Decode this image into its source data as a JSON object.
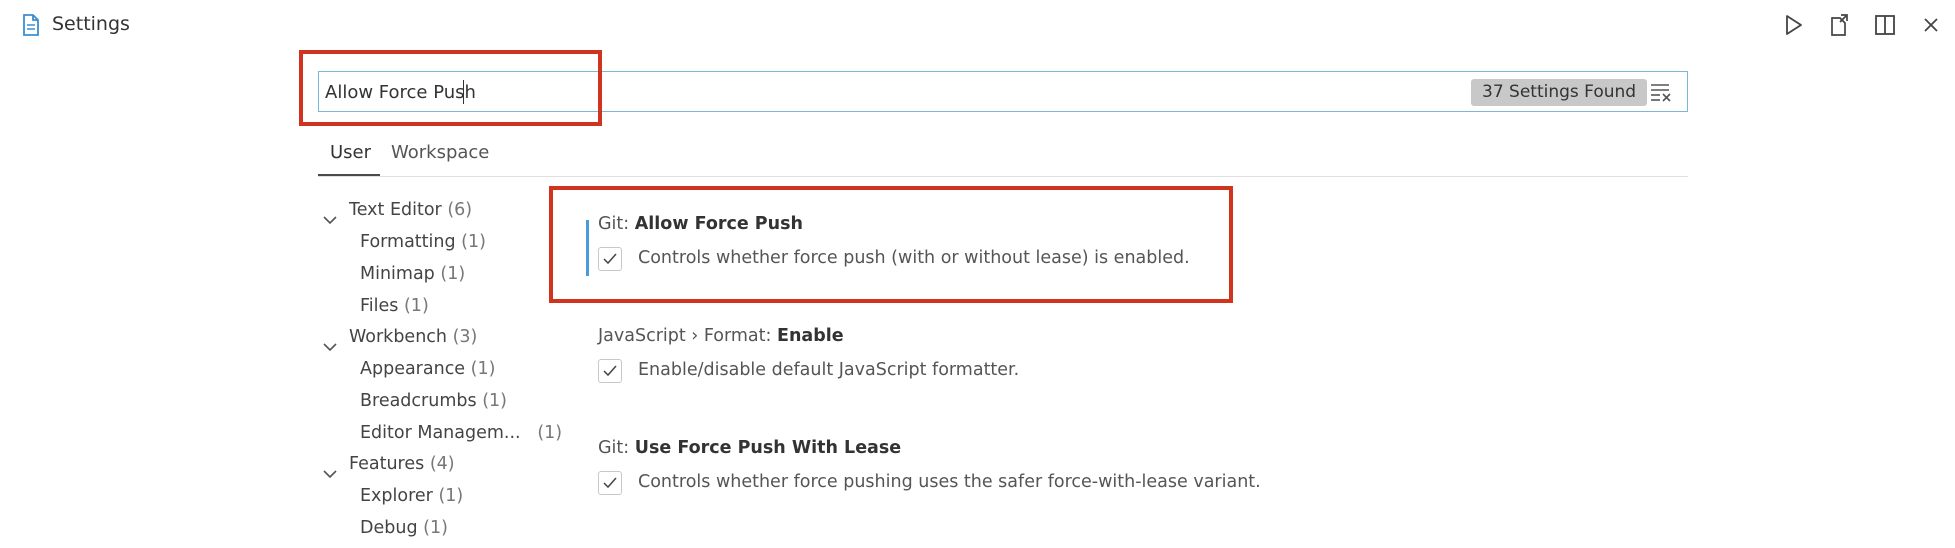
{
  "editor": {
    "tab_title": "Settings",
    "actions": [
      {
        "name": "run-icon"
      },
      {
        "name": "open-settings-json-icon"
      },
      {
        "name": "split-editor-icon"
      },
      {
        "name": "close-icon"
      }
    ]
  },
  "search": {
    "value": "Allow Force Push",
    "results_count": "37 Settings Found",
    "clear_icon": "clear-filter-icon"
  },
  "scope_tabs": [
    {
      "label": "User",
      "active": true
    },
    {
      "label": "Workspace",
      "active": false
    }
  ],
  "toc": [
    {
      "label": "Text Editor",
      "count": "(6)",
      "level": 0,
      "expanded": true
    },
    {
      "label": "Formatting",
      "count": "(1)",
      "level": 1
    },
    {
      "label": "Minimap",
      "count": "(1)",
      "level": 1
    },
    {
      "label": "Files",
      "count": "(1)",
      "level": 1
    },
    {
      "label": "Workbench",
      "count": "(3)",
      "level": 0,
      "expanded": true
    },
    {
      "label": "Appearance",
      "count": "(1)",
      "level": 1
    },
    {
      "label": "Breadcrumbs",
      "count": "(1)",
      "level": 1
    },
    {
      "label": "Editor Managem...",
      "count": "(1)",
      "level": 1
    },
    {
      "label": "Features",
      "count": "(4)",
      "level": 0,
      "expanded": true
    },
    {
      "label": "Explorer",
      "count": "(1)",
      "level": 1
    },
    {
      "label": "Debug",
      "count": "(1)",
      "level": 1
    }
  ],
  "settings": [
    {
      "category": "Git: ",
      "name": "Allow Force Push",
      "checked": true,
      "description": "Controls whether force push (with or without lease) is enabled."
    },
    {
      "category": "JavaScript › Format: ",
      "name": "Enable",
      "checked": true,
      "description": "Enable/disable default JavaScript formatter."
    },
    {
      "category": "Git: ",
      "name": "Use Force Push With Lease",
      "checked": true,
      "description": "Controls whether force pushing uses the safer force-with-lease variant."
    }
  ],
  "colors": {
    "highlight_border": "#d0341f",
    "focus_bar": "#4b9bd8",
    "search_border": "#7ab9d6",
    "badge_bg": "#c8c8c8"
  }
}
